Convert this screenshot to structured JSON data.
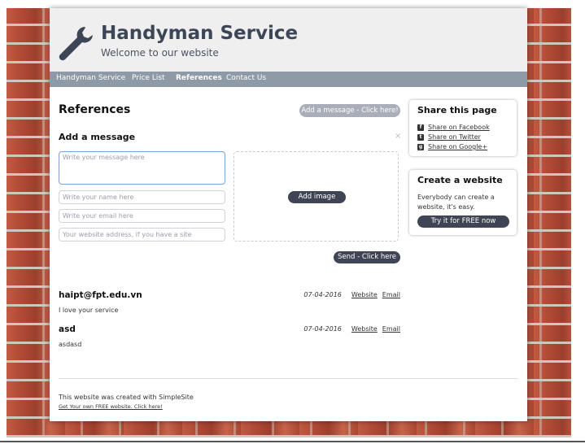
{
  "site": {
    "title": "Handyman Service",
    "subtitle": "Welcome to our website",
    "logo_icon": "wrench-icon"
  },
  "nav": {
    "items": [
      {
        "label": "Handyman Service",
        "active": false
      },
      {
        "label": "Price List",
        "active": false
      },
      {
        "label": "References",
        "active": true
      },
      {
        "label": "Contact Us",
        "active": false
      }
    ]
  },
  "main": {
    "heading": "References",
    "add_message_button": "Add a message - Click here!",
    "add_message_heading": "Add a message",
    "close_symbol": "×",
    "form": {
      "message_placeholder": "Write your message here",
      "name_placeholder": "Write your name here",
      "email_placeholder": "Write your email here",
      "website_placeholder": "Your website address, if you have a site",
      "add_image_button": "Add image",
      "send_button": "Send - Click here"
    },
    "entries": [
      {
        "author": "haipt@fpt.edu.vn",
        "date": "07-04-2016",
        "website_link": "Website",
        "email_link": "Email",
        "text": "I love your service"
      },
      {
        "author": "asd",
        "date": "07-04-2016",
        "website_link": "Website",
        "email_link": "Email",
        "text": "asdasd"
      }
    ]
  },
  "sidebar": {
    "share": {
      "title": "Share this page",
      "items": [
        {
          "label": "Share on Facebook",
          "icon": "facebook-icon"
        },
        {
          "label": "Share on Twitter",
          "icon": "twitter-icon"
        },
        {
          "label": "Share on Google+",
          "icon": "google-plus-icon"
        }
      ]
    },
    "create": {
      "title": "Create a website",
      "description": "Everybody can create a website, it's easy.",
      "button": "Try it for FREE now"
    }
  },
  "footer": {
    "text": "This website was created with SimpleSite",
    "link": "Get Your own FREE website. Click here!"
  },
  "colors": {
    "header_bg": "#efefef",
    "nav_bg": "#8e9aa6",
    "button_dark": "#3f4555",
    "button_light": "#a9aeb8",
    "brick": "#b24f3a"
  }
}
